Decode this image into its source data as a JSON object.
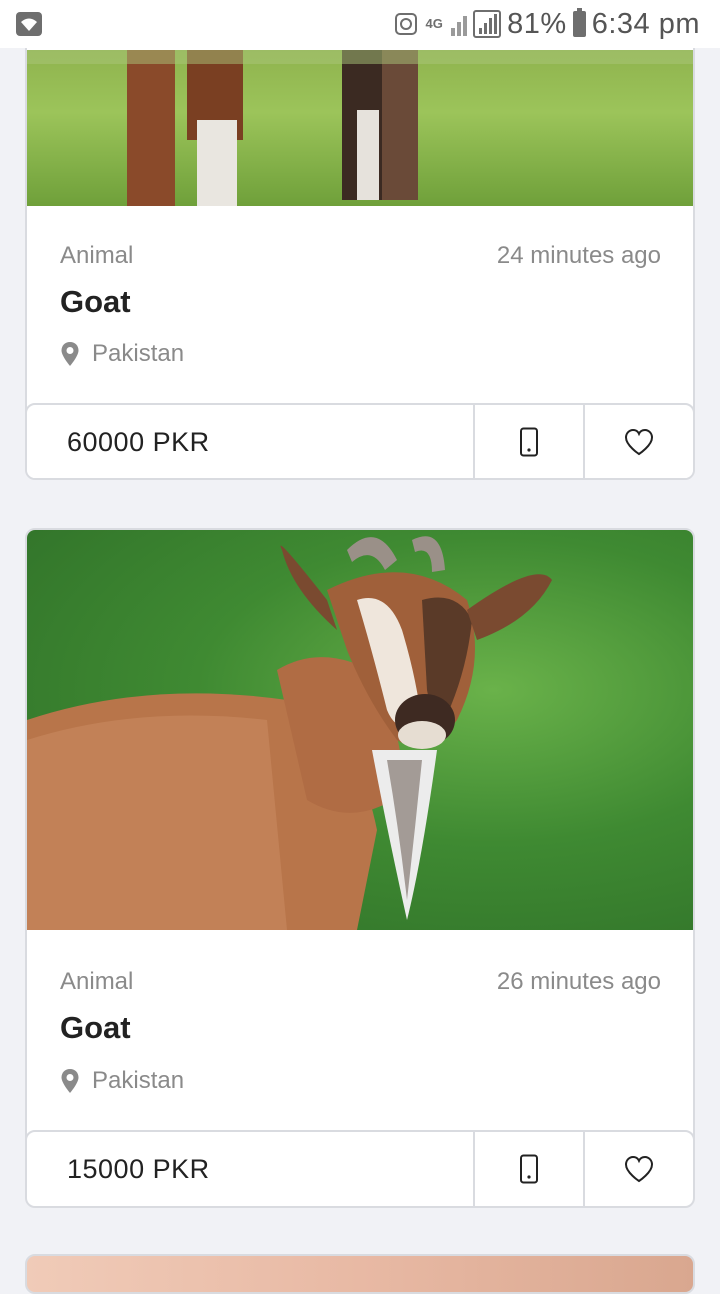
{
  "status_bar": {
    "network": "4G",
    "battery": "81%",
    "time": "6:34 pm"
  },
  "listings": [
    {
      "category": "Animal",
      "time_ago": "24 minutes ago",
      "title": "Goat",
      "location": "Pakistan",
      "price": "60000 PKR"
    },
    {
      "category": "Animal",
      "time_ago": "26 minutes ago",
      "title": "Goat",
      "location": "Pakistan",
      "price": "15000 PKR"
    }
  ],
  "icons": {
    "location": "map-pin-icon",
    "call": "phone-icon",
    "favorite": "heart-icon"
  }
}
